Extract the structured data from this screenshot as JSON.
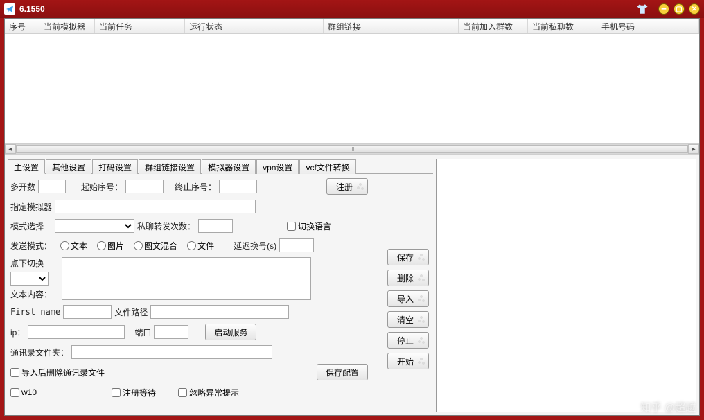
{
  "window": {
    "title": "6.1550"
  },
  "grid": {
    "columns": [
      "序号",
      "当前模拟器",
      "当前任务",
      "运行状态",
      "群组链接",
      "当前加入群数",
      "当前私聊数",
      "手机号码"
    ]
  },
  "tabs": [
    "主设置",
    "其他设置",
    "打码设置",
    "群组链接设置",
    "模拟器设置",
    "vpn设置",
    "vcf文件转换"
  ],
  "form": {
    "multi_open_label": "多开数",
    "start_seq_label": "起始序号：",
    "end_seq_label": "终止序号：",
    "register_btn": "注册",
    "assign_emu_label": "指定模拟器",
    "mode_select_label": "模式选择",
    "pm_forward_label": "私聊转发次数：",
    "switch_lang_label": "切换语言",
    "send_mode_label": "发送模式：",
    "send_modes": {
      "text": "文本",
      "image": "图片",
      "mixed": "图文混合",
      "file": "文件"
    },
    "delay_label": "延迟换号(s)",
    "click_switch_label": "点下切换",
    "text_content_label": "文本内容：",
    "first_name_label": "First name",
    "file_path_label": "文件路径",
    "ip_label": "ip：",
    "port_label": "端口",
    "start_service_btn": "启动服务",
    "contacts_folder_label": "通讯录文件夹：",
    "delete_contacts_after_import": "导入后删除通讯录文件",
    "save_config_btn": "保存配置",
    "w10_label": "w10",
    "reg_wait_label": "注册等待",
    "ignore_exception_label": "忽略异常提示"
  },
  "side_buttons": {
    "save": "保存",
    "delete": "删除",
    "import": "导入",
    "clear": "清空",
    "stop": "停止",
    "start": "开始"
  },
  "watermark": "知乎 @超越"
}
